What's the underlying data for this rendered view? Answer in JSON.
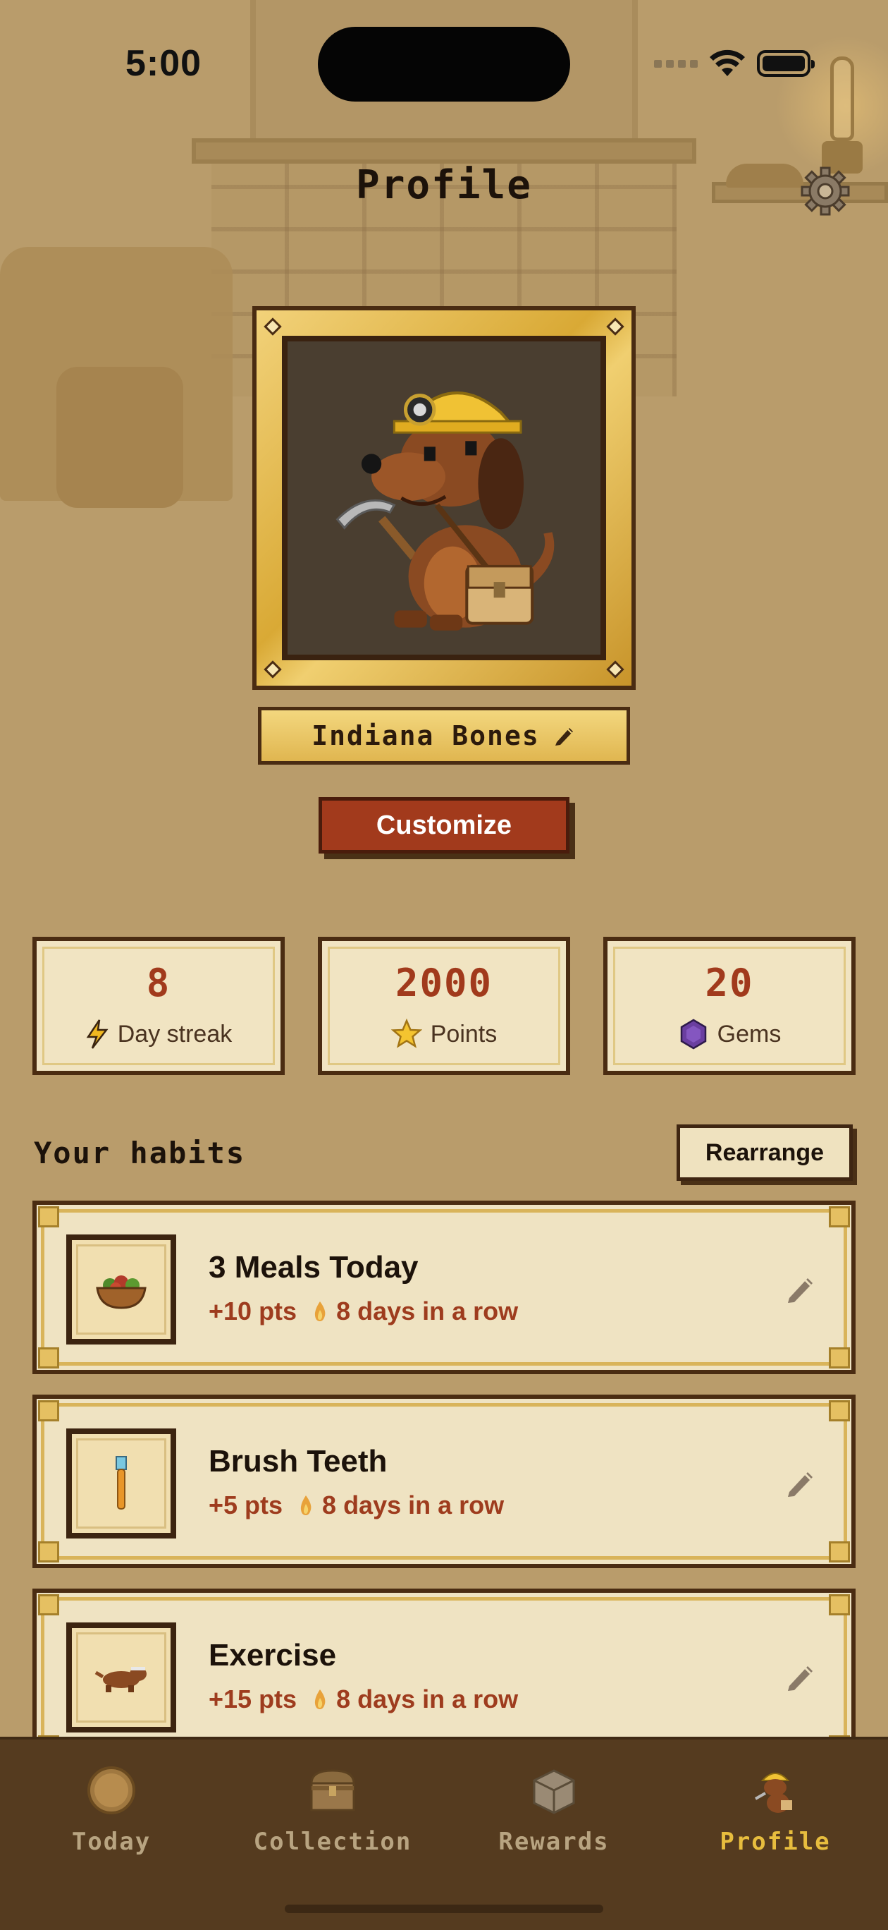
{
  "status_bar": {
    "time": "5:00"
  },
  "header": {
    "title": "Profile"
  },
  "pet": {
    "name": "Indiana Bones"
  },
  "actions": {
    "customize_label": "Customize",
    "rearrange_label": "Rearrange"
  },
  "stats": [
    {
      "value": "8",
      "label": "Day streak",
      "icon": "lightning-icon"
    },
    {
      "value": "2000",
      "label": "Points",
      "icon": "star-icon"
    },
    {
      "value": "20",
      "label": "Gems",
      "icon": "gem-icon"
    }
  ],
  "habits_section": {
    "title": "Your habits"
  },
  "habits": [
    {
      "name": "3 Meals Today",
      "points": "+10 pts",
      "streak": "8 days in a row",
      "icon": "salad-bowl-icon"
    },
    {
      "name": "Brush Teeth",
      "points": "+5 pts",
      "streak": "8 days in a row",
      "icon": "toothbrush-icon"
    },
    {
      "name": "Exercise",
      "points": "+15 pts",
      "streak": "8 days in a row",
      "icon": "running-dog-icon"
    }
  ],
  "tabs": [
    {
      "label": "Today",
      "icon": "coin-icon",
      "active": false
    },
    {
      "label": "Collection",
      "icon": "chest-icon",
      "active": false
    },
    {
      "label": "Rewards",
      "icon": "crate-icon",
      "active": false
    },
    {
      "label": "Profile",
      "icon": "dog-miner-icon",
      "active": true
    }
  ],
  "colors": {
    "background": "#b99c6b",
    "accent_red": "#a23a1c",
    "card_fill": "#efe3c2",
    "tab_bar": "#553b1f",
    "tab_active": "#e7bd3e",
    "tab_inactive": "#b8a481"
  }
}
